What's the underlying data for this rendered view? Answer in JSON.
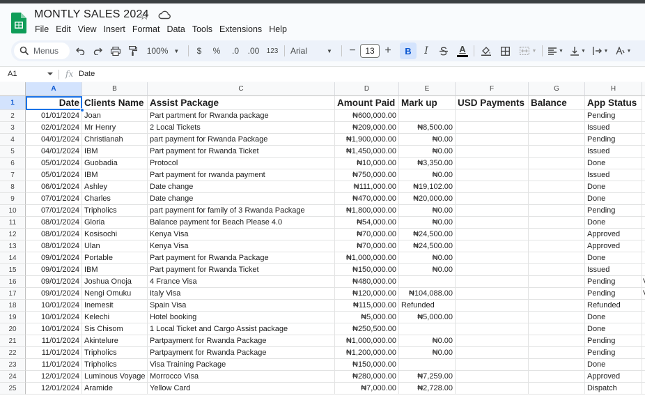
{
  "app": {
    "title": "MONTLY SALES 2024",
    "menu": [
      "File",
      "Edit",
      "View",
      "Insert",
      "Format",
      "Data",
      "Tools",
      "Extensions",
      "Help"
    ]
  },
  "toolbar": {
    "search_label": "Menus",
    "zoom": "100%",
    "currency": "$",
    "percent": "%",
    "dec_decrease": ".0",
    "dec_increase": ".00",
    "number_format": "123",
    "font": "Arial",
    "font_size": "13",
    "bold": "B",
    "italic": "I",
    "text_color": "A"
  },
  "formula_bar": {
    "name_box": "A1",
    "fx": "fx",
    "value": "Date"
  },
  "columns": [
    "A",
    "B",
    "C",
    "D",
    "E",
    "F",
    "G",
    "H"
  ],
  "headers": [
    "Date",
    "Clients Name",
    "Assist Package",
    "Amount Paid",
    "Mark up",
    "USD Payments",
    "Balance",
    "App Status"
  ],
  "rows": [
    {
      "n": "2",
      "date": "01/01/2024",
      "client": "Joan",
      "package": "Part partment for Rwanda package",
      "paid": "₦600,000.00",
      "markup": "",
      "usd": "",
      "balance": "",
      "status": "Pending"
    },
    {
      "n": "3",
      "date": "02/01/2024",
      "client": "Mr Henry",
      "package": "2 Local Tickets",
      "paid": "₦209,000.00",
      "markup": "₦8,500.00",
      "usd": "",
      "balance": "",
      "status": "Issued"
    },
    {
      "n": "4",
      "date": "04/01/2024",
      "client": "Christianah",
      "package": "part payment for Rwanda Package",
      "paid": "₦1,900,000.00",
      "markup": "₦0.00",
      "usd": "",
      "balance": "",
      "status": "Pending"
    },
    {
      "n": "5",
      "date": "04/01/2024",
      "client": "IBM",
      "package": "Part payment for Rwanda Ticket",
      "paid": "₦1,450,000.00",
      "markup": "₦0.00",
      "usd": "",
      "balance": "",
      "status": "Issued"
    },
    {
      "n": "6",
      "date": "05/01/2024",
      "client": "Guobadia",
      "package": "Protocol",
      "paid": "₦10,000.00",
      "markup": "₦3,350.00",
      "usd": "",
      "balance": "",
      "status": "Done"
    },
    {
      "n": "7",
      "date": "05/01/2024",
      "client": "IBM",
      "package": "Part payment for rwanda payment",
      "paid": "₦750,000.00",
      "markup": "₦0.00",
      "usd": "",
      "balance": "",
      "status": "Issued"
    },
    {
      "n": "8",
      "date": "06/01/2024",
      "client": "Ashley",
      "package": "Date change",
      "paid": "₦111,000.00",
      "markup": "₦19,102.00",
      "usd": "",
      "balance": "",
      "status": "Done"
    },
    {
      "n": "9",
      "date": "07/01/2024",
      "client": "Charles",
      "package": "Date change",
      "paid": "₦470,000.00",
      "markup": "₦20,000.00",
      "usd": "",
      "balance": "",
      "status": "Done"
    },
    {
      "n": "10",
      "date": "07/01/2024",
      "client": "Tripholics",
      "package": "part payment for family of 3 Rwanda Package",
      "paid": "₦1,800,000.00",
      "markup": "₦0.00",
      "usd": "",
      "balance": "",
      "status": "Pending"
    },
    {
      "n": "11",
      "date": "08/01/2024",
      "client": "Gloria",
      "package": "Balance payment for Beach Please 4.0",
      "paid": "₦54,000.00",
      "markup": "₦0.00",
      "usd": "",
      "balance": "",
      "status": "Done"
    },
    {
      "n": "12",
      "date": "08/01/2024",
      "client": "Kosisochi",
      "package": "Kenya Visa",
      "paid": "₦70,000.00",
      "markup": "₦24,500.00",
      "usd": "",
      "balance": "",
      "status": "Approved"
    },
    {
      "n": "13",
      "date": "08/01/2024",
      "client": "Ulan",
      "package": "Kenya Visa",
      "paid": "₦70,000.00",
      "markup": "₦24,500.00",
      "usd": "",
      "balance": "",
      "status": "Approved"
    },
    {
      "n": "14",
      "date": "09/01/2024",
      "client": "Portable",
      "package": "Part payment for Rwanda Package",
      "paid": "₦1,000,000.00",
      "markup": "₦0.00",
      "usd": "",
      "balance": "",
      "status": "Done"
    },
    {
      "n": "15",
      "date": "09/01/2024",
      "client": "IBM",
      "package": "Part payment for Rwanda Ticket",
      "paid": "₦150,000.00",
      "markup": "₦0.00",
      "usd": "",
      "balance": "",
      "status": "Issued"
    },
    {
      "n": "16",
      "date": "09/01/2024",
      "client": "Joshua Onoja",
      "package": "4 France Visa",
      "paid": "₦480,000.00",
      "markup": "",
      "usd": "",
      "balance": "",
      "status": "Pending"
    },
    {
      "n": "17",
      "date": "09/01/2024",
      "client": "Nengi Omuku",
      "package": "Italy Visa",
      "paid": "₦120,000.00",
      "markup": "₦104,088.00",
      "usd": "",
      "balance": "",
      "status": "Pending"
    },
    {
      "n": "18",
      "date": "10/01/2024",
      "client": "Inemesit",
      "package": "Spain Visa",
      "paid": "₦115,000.00",
      "markup": "Refunded",
      "usd": "",
      "balance": "",
      "status": "Refunded"
    },
    {
      "n": "19",
      "date": "10/01/2024",
      "client": "Kelechi",
      "package": "Hotel booking",
      "paid": "₦5,000.00",
      "markup": "₦5,000.00",
      "usd": "",
      "balance": "",
      "status": "Done"
    },
    {
      "n": "20",
      "date": "10/01/2024",
      "client": "Sis Chisom",
      "package": "1 Local Ticket and Cargo Assist package",
      "paid": "₦250,500.00",
      "markup": "",
      "usd": "",
      "balance": "",
      "status": "Done"
    },
    {
      "n": "21",
      "date": "11/01/2024",
      "client": "Akintelure",
      "package": "Partpayment for Rwanda Package",
      "paid": "₦1,000,000.00",
      "markup": "₦0.00",
      "usd": "",
      "balance": "",
      "status": "Pending"
    },
    {
      "n": "22",
      "date": "11/01/2024",
      "client": "Tripholics",
      "package": "Partpayment for Rwanda Package",
      "paid": "₦1,200,000.00",
      "markup": "₦0.00",
      "usd": "",
      "balance": "",
      "status": "Pending"
    },
    {
      "n": "23",
      "date": "11/01/2024",
      "client": "Tripholics",
      "package": "Visa Training Package",
      "paid": "₦150,000.00",
      "markup": "",
      "usd": "",
      "balance": "",
      "status": "Done"
    },
    {
      "n": "24",
      "date": "12/01/2024",
      "client": "Luminous Voyage",
      "package": "Morrocco Visa",
      "paid": "₦280,000.00",
      "markup": "₦7,259.00",
      "usd": "",
      "balance": "",
      "status": "Approved"
    },
    {
      "n": "25",
      "date": "12/01/2024",
      "client": "Aramide",
      "package": "Yellow Card",
      "paid": "₦7,000.00",
      "markup": "₦2,728.00",
      "usd": "",
      "balance": "",
      "status": "Dispatch"
    }
  ],
  "overflow_text": "V",
  "colors": {
    "accent": "#0b57d0",
    "selection": "#1a73e8",
    "sheets_green": "#0f9d58",
    "toolbar_bg": "#edf2fa"
  },
  "icons": [
    "sheets-logo-icon",
    "star-icon",
    "cloud-status-icon",
    "search-icon",
    "undo-icon",
    "redo-icon",
    "print-icon",
    "paint-format-icon",
    "minus-icon",
    "plus-icon",
    "strikethrough-icon",
    "fill-color-icon",
    "borders-icon",
    "merge-cells-icon",
    "align-icon",
    "valign-icon",
    "text-wrap-icon",
    "text-rotate-icon"
  ]
}
